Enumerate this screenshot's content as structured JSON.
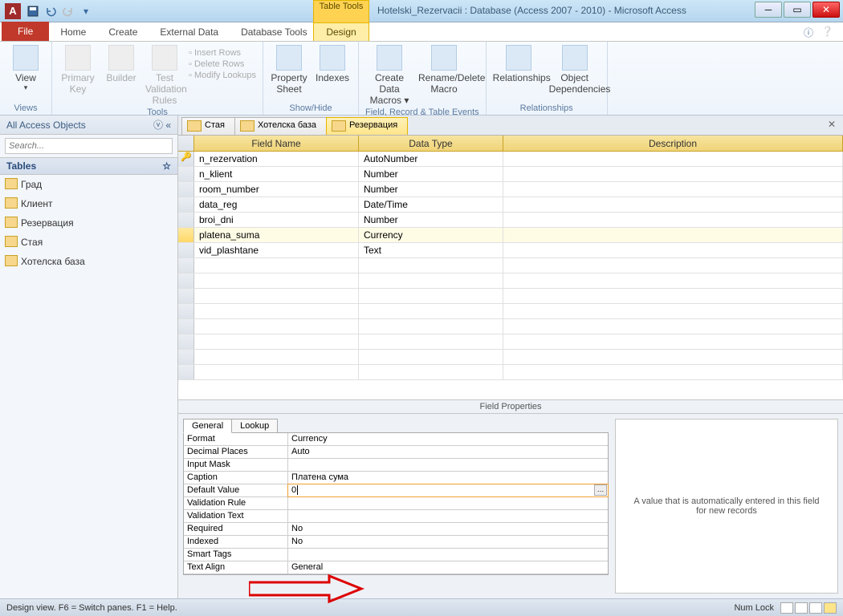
{
  "title": {
    "context_tab": "Table Tools",
    "doc": "Hotelski_Rezervacii : Database (Access 2007 - 2010)  -  Microsoft Access",
    "app_letter": "A"
  },
  "ribbon_tabs": {
    "file": "File",
    "home": "Home",
    "create": "Create",
    "external": "External Data",
    "dbtools": "Database Tools",
    "design": "Design"
  },
  "ribbon": {
    "views": {
      "view": "View",
      "group": "Views"
    },
    "tools": {
      "primary_key": "Primary Key",
      "builder": "Builder",
      "test_rules": "Test Validation Rules",
      "insert_rows": "Insert Rows",
      "delete_rows": "Delete Rows",
      "modify_lookups": "Modify Lookups",
      "group": "Tools"
    },
    "showhide": {
      "property_sheet": "Property Sheet",
      "indexes": "Indexes",
      "group": "Show/Hide"
    },
    "events": {
      "create_macros": "Create Data Macros ▾",
      "rename_delete": "Rename/Delete Macro",
      "group": "Field, Record & Table Events"
    },
    "relationships": {
      "relationships": "Relationships",
      "obj_deps": "Object Dependencies",
      "group": "Relationships"
    }
  },
  "nav": {
    "header": "All Access Objects",
    "search_placeholder": "Search...",
    "tables_label": "Tables",
    "items": [
      "Град",
      "Клиент",
      "Резервация",
      "Стая",
      "Хотелска база"
    ]
  },
  "doc_tabs": [
    "Стая",
    "Хотелска база",
    "Резервация"
  ],
  "grid": {
    "headers": {
      "field_name": "Field Name",
      "data_type": "Data Type",
      "description": "Description"
    },
    "rows": [
      {
        "name": "n_rezervation",
        "type": "AutoNumber",
        "pk": true
      },
      {
        "name": "n_klient",
        "type": "Number"
      },
      {
        "name": "room_number",
        "type": "Number"
      },
      {
        "name": "data_reg",
        "type": "Date/Time"
      },
      {
        "name": "broi_dni",
        "type": "Number"
      },
      {
        "name": "platena_suma",
        "type": "Currency",
        "current": true
      },
      {
        "name": "vid_plashtane",
        "type": "Text"
      }
    ]
  },
  "fp": {
    "title": "Field Properties",
    "tab_general": "General",
    "tab_lookup": "Lookup",
    "props": [
      {
        "label": "Format",
        "value": "Currency"
      },
      {
        "label": "Decimal Places",
        "value": "Auto"
      },
      {
        "label": "Input Mask",
        "value": ""
      },
      {
        "label": "Caption",
        "value": "Платена сума"
      },
      {
        "label": "Default Value",
        "value": "0",
        "active": true,
        "builder": true
      },
      {
        "label": "Validation Rule",
        "value": ""
      },
      {
        "label": "Validation Text",
        "value": ""
      },
      {
        "label": "Required",
        "value": "No"
      },
      {
        "label": "Indexed",
        "value": "No"
      },
      {
        "label": "Smart Tags",
        "value": ""
      },
      {
        "label": "Text Align",
        "value": "General"
      }
    ],
    "help": "A value that is automatically entered in this field for new records"
  },
  "status": {
    "left": "Design view.   F6 = Switch panes.   F1 = Help.",
    "numlock": "Num Lock"
  }
}
